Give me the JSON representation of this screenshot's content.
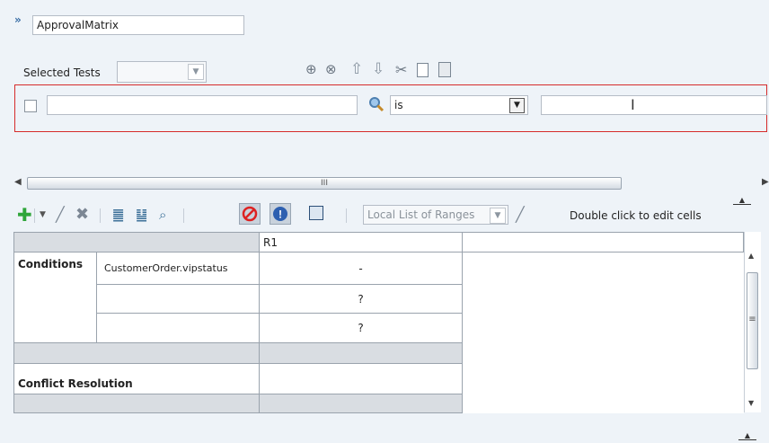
{
  "header": {
    "collapse_icon": "double-chevron-icon",
    "name_value": "ApprovalMatrix"
  },
  "tests": {
    "label": "Selected Tests",
    "select_value": "",
    "toolbar_icons": [
      "add-test-icon",
      "remove-test-icon",
      "move-up-icon",
      "move-down-icon",
      "cut-icon",
      "copy-icon",
      "paste-icon"
    ]
  },
  "filter": {
    "checkbox_checked": false,
    "left_value": "",
    "operator": "is",
    "right_value": ""
  },
  "scrollbar": {
    "thumb_label": "III"
  },
  "toolbar": {
    "range_label": "Local List of Ranges",
    "hint": "Double click to edit cells",
    "icons": [
      "add-icon",
      "dropdown-arrow-icon",
      "edit-icon",
      "delete-icon",
      "insert-column-icon",
      "insert-column-alt-icon",
      "find-icon",
      "disable-icon",
      "validate-icon",
      "toggle-icon",
      "range-edit-icon"
    ]
  },
  "grid": {
    "column_header": "R1",
    "conditions_label": "Conditions",
    "condition_rows": [
      {
        "label": "CustomerOrder.vipstatus",
        "value": "-"
      },
      {
        "label": "",
        "value": "?"
      },
      {
        "label": "",
        "value": "?"
      }
    ],
    "conflict_label": "Conflict Resolution",
    "scroll_thumb": "≡"
  }
}
